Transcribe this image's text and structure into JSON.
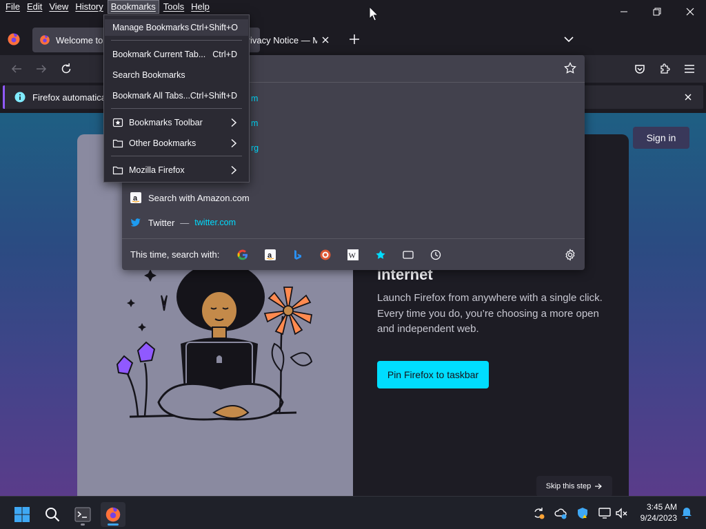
{
  "menubar": {
    "items": [
      {
        "label": "File"
      },
      {
        "label": "Edit"
      },
      {
        "label": "View"
      },
      {
        "label": "History"
      },
      {
        "label": "Bookmarks"
      },
      {
        "label": "Tools"
      },
      {
        "label": "Help"
      }
    ],
    "open_menu": "Bookmarks"
  },
  "tabs": {
    "active_title": "Welcome to Firefox",
    "inactive_title": "Privacy Notice — Mozilla"
  },
  "notification": {
    "text": "Firefox automatically"
  },
  "bookmarks_menu": {
    "items": [
      {
        "label": "Manage Bookmarks",
        "shortcut": "Ctrl+Shift+O"
      },
      {
        "label": "Bookmark Current Tab...",
        "shortcut": "Ctrl+D"
      },
      {
        "label": "Search Bookmarks",
        "shortcut": ""
      },
      {
        "label": "Bookmark All Tabs...",
        "shortcut": "Ctrl+Shift+D"
      },
      {
        "label": "Bookmarks Toolbar",
        "shortcut": ""
      },
      {
        "label": "Other Bookmarks",
        "shortcut": ""
      },
      {
        "label": "Mozilla Firefox",
        "shortcut": ""
      }
    ]
  },
  "url_dropdown": {
    "partial_urls": [
      "m",
      "m",
      "rg"
    ],
    "results": [
      {
        "title": "Search with Amazon.com",
        "url": ""
      },
      {
        "title": "Twitter",
        "separator": "—",
        "url": "twitter.com"
      }
    ],
    "oneoff_label": "This time, search with:",
    "engines": [
      "google-icon",
      "amazon-icon",
      "bing-icon",
      "duckduckgo-icon",
      "wikipedia-icon",
      "bookmarks-icon",
      "tabs-icon",
      "history-icon"
    ]
  },
  "page": {
    "signin_label": "Sign in",
    "headline": "internet",
    "description": "Launch Firefox from anywhere with a single click. Every time you do, you’re choosing a more open and independent web.",
    "pin_button": "Pin Firefox to taskbar",
    "skip_button": "Skip this step"
  },
  "clock": {
    "time": "3:45 AM",
    "date": "9/24/2023"
  },
  "colors": {
    "accent": "#00ddff",
    "chrome_bg": "#1c1b22",
    "toolbar_bg": "#2b2a33",
    "panel_bg": "#42414d",
    "notification_accent": "#9059ff"
  }
}
